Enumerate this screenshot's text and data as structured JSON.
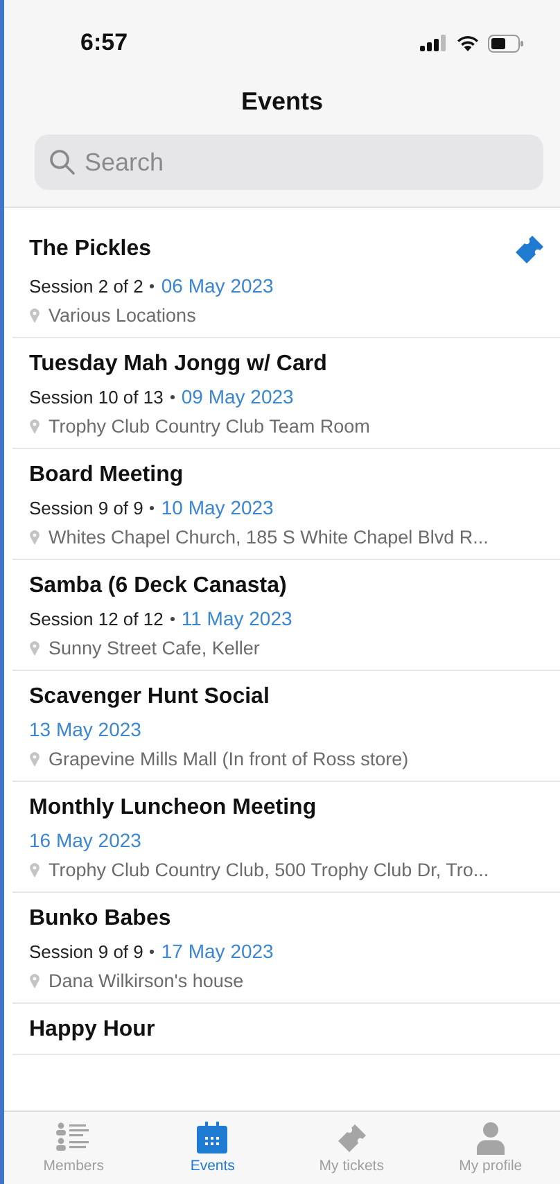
{
  "status_bar": {
    "time": "6:57"
  },
  "header": {
    "title": "Events"
  },
  "search": {
    "placeholder": "Search"
  },
  "events": [
    {
      "title": "The Pickles",
      "session": "Session 2 of 2",
      "date": "06 May 2023",
      "location": "Various Locations",
      "ticket": true
    },
    {
      "title": "Tuesday Mah Jongg w/ Card",
      "session": "Session 10 of 13",
      "date": "09 May 2023",
      "location": "Trophy Club Country Club Team Room",
      "ticket": false
    },
    {
      "title": "Board Meeting",
      "session": "Session 9 of 9",
      "date": "10 May 2023",
      "location": "Whites Chapel Church, 185 S White Chapel Blvd  R...",
      "ticket": false
    },
    {
      "title": "Samba (6 Deck Canasta)",
      "session": "Session 12 of 12",
      "date": "11 May 2023",
      "location": "Sunny Street Cafe, Keller",
      "ticket": false
    },
    {
      "title": "Scavenger Hunt Social",
      "date": "13 May 2023",
      "location": "Grapevine Mills Mall (In front of Ross store)",
      "ticket": false
    },
    {
      "title": "Monthly Luncheon Meeting",
      "date": "16 May 2023",
      "location": "Trophy Club Country Club, 500 Trophy Club Dr, Tro...",
      "ticket": false
    },
    {
      "title": "Bunko Babes",
      "session": "Session 9 of 9",
      "date": "17 May 2023",
      "location": "Dana Wilkirson's house",
      "ticket": false
    },
    {
      "title": "Happy Hour",
      "ticket": false
    }
  ],
  "tab_bar": [
    {
      "label": "Members",
      "kind": "members",
      "selected": false
    },
    {
      "label": "Events",
      "kind": "events",
      "selected": true
    },
    {
      "label": "My tickets",
      "kind": "tickets",
      "selected": false
    },
    {
      "label": "My profile",
      "kind": "profile",
      "selected": false
    }
  ]
}
